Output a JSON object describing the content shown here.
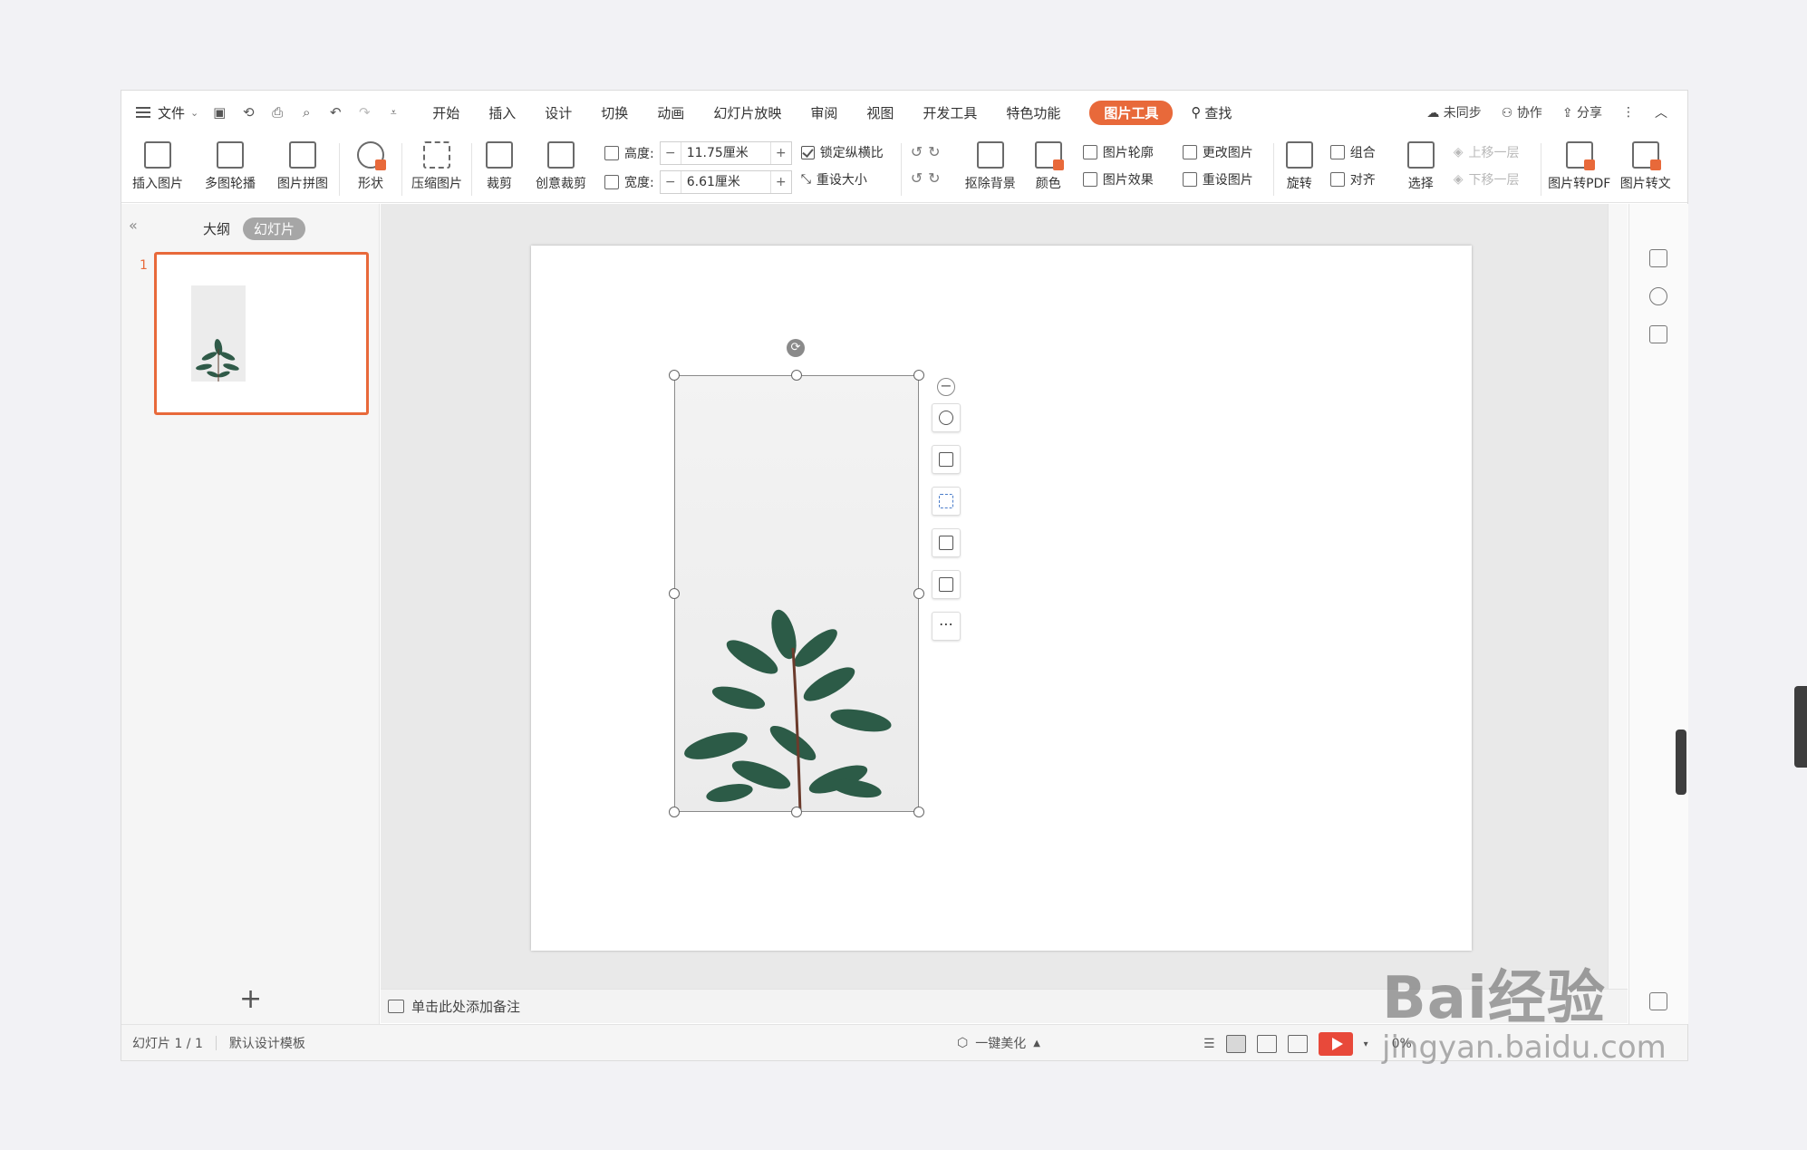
{
  "menubar": {
    "file": "文件",
    "tabs": [
      "开始",
      "插入",
      "设计",
      "切换",
      "动画",
      "幻灯片放映",
      "审阅",
      "视图",
      "开发工具",
      "特色功能"
    ],
    "active_tool_tab": "图片工具",
    "search": "查找",
    "sync": "未同步",
    "collab": "协作",
    "share": "分享"
  },
  "ribbon": {
    "insert_picture": "插入图片",
    "multi_carousel": "多图轮播",
    "picture_collage": "图片拼图",
    "shape": "形状",
    "compress": "压缩图片",
    "crop": "裁剪",
    "creative_crop": "创意裁剪",
    "height_label": "高度:",
    "height_value": "11.75厘米",
    "width_label": "宽度:",
    "width_value": "6.61厘米",
    "lock_ratio": "锁定纵横比",
    "reset_size": "重设大小",
    "remove_bg": "抠除背景",
    "color": "颜色",
    "outline": "图片轮廓",
    "effect": "图片效果",
    "change_pic": "更改图片",
    "reset_pic": "重设图片",
    "rotate": "旋转",
    "group": "组合",
    "align": "对齐",
    "select": "选择",
    "bring_forward": "上移一层",
    "send_backward": "下移一层",
    "to_pdf": "图片转PDF",
    "to_text": "图片转文"
  },
  "panel": {
    "tab_outline": "大纲",
    "tab_slides": "幻灯片",
    "slide_number": "1"
  },
  "notes": {
    "placeholder": "单击此处添加备注"
  },
  "statusbar": {
    "slide_info": "幻灯片 1 / 1",
    "template": "默认设计模板",
    "beautify": "一键美化",
    "zoom": "0%"
  },
  "watermark": {
    "brand": "Bai经验",
    "url": "jingyan.baidu.com"
  },
  "colors": {
    "accent": "#e8693a",
    "play": "#e8493a"
  }
}
